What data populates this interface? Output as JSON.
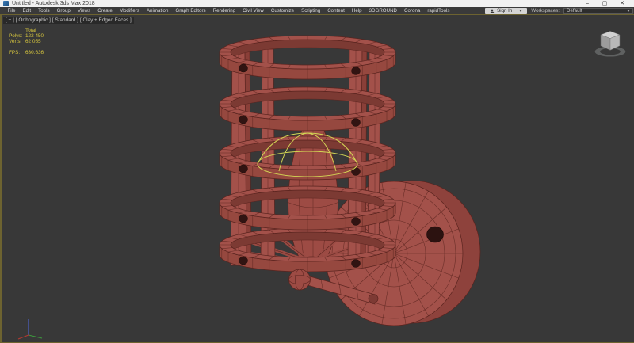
{
  "window": {
    "title": "Untitled - Autodesk 3ds Max 2018",
    "minimize": "–",
    "maximize": "▢",
    "close": "✕"
  },
  "menu": {
    "items": [
      "File",
      "Edit",
      "Tools",
      "Group",
      "Views",
      "Create",
      "Modifiers",
      "Animation",
      "Graph Editors",
      "Rendering",
      "Civil View",
      "Customize",
      "Scripting",
      "Content",
      "Help",
      "3DGROUND",
      "Corona",
      "rapidTools"
    ]
  },
  "account": {
    "sign_in": "Sign In"
  },
  "workspaces": {
    "label": "Workspaces:",
    "selected": "Default"
  },
  "viewport": {
    "label_segments": [
      "[ + ]",
      "[ Orthographic ]",
      "[ Standard ]",
      "[ Clay + Edged Faces ]"
    ],
    "stats": {
      "total_label": "Total",
      "polys_label": "Polys:",
      "polys_value": "122 450",
      "verts_label": "Verts:",
      "verts_value": "62 055",
      "fps_label": "FPS:",
      "fps_value": "630.636"
    },
    "scene_description": "Wall-mounted cage lamp 3D model in clay red with edged-faces wireframe, yellow light gizmo inside, circular wall plate, ViewCube top-right, world axis tripod bottom-left"
  },
  "colors": {
    "titlebar_bg": "#f1f1f1",
    "menu_bg": "#3a3a3a",
    "viewport_bg": "#383838",
    "border_olive": "#6d6330",
    "stats_text": "#d6c53e",
    "clay": "#a3514a",
    "clay_edge": "#5a241f",
    "gizmo": "#d3d654"
  }
}
